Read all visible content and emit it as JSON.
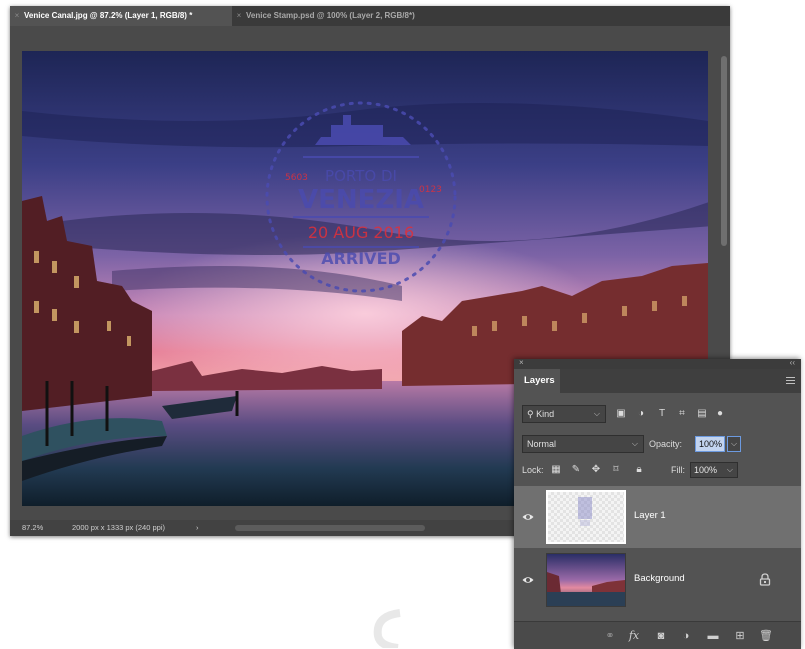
{
  "tabs": [
    {
      "close": "×",
      "label": "Venice Canal.jpg @ 87.2% (Layer 1, RGB/8) *",
      "active": true
    },
    {
      "close": "×",
      "label": "Venice Stamp.psd @ 100% (Layer 2, RGB/8*)",
      "active": false
    }
  ],
  "stamp": {
    "city_top": "PORTO DI",
    "city": "VENEZIA",
    "date": "20 AUG 2016",
    "status": "ARRIVED",
    "code_left": "5603",
    "code_right": "0123"
  },
  "status_bar": {
    "zoom": "87.2%",
    "doc_info": "2000 px x 1333 px (240 ppi)",
    "arrow": "›"
  },
  "panel": {
    "close": "×",
    "collapse": "‹‹",
    "tab_label": "Layers",
    "filter_kind": "Kind",
    "blend_mode": "Normal",
    "opacity_label": "Opacity:",
    "opacity_value": "100%",
    "lock_label": "Lock:",
    "fill_label": "Fill:",
    "fill_value": "100%",
    "layers": [
      {
        "name": "Layer 1",
        "visible": true,
        "selected": true,
        "locked": false
      },
      {
        "name": "Background",
        "visible": true,
        "selected": false,
        "locked": true
      }
    ],
    "bottom_icons": [
      "link-icon",
      "fx-icon",
      "mask-icon",
      "adjustment-icon",
      "folder-icon",
      "new-layer-icon",
      "trash-icon"
    ],
    "fx_label": "fx"
  },
  "colors": {
    "stamp_blue": "#4a4bb0",
    "stamp_red": "#e0303a",
    "selection_blue": "#6c9ae0"
  }
}
